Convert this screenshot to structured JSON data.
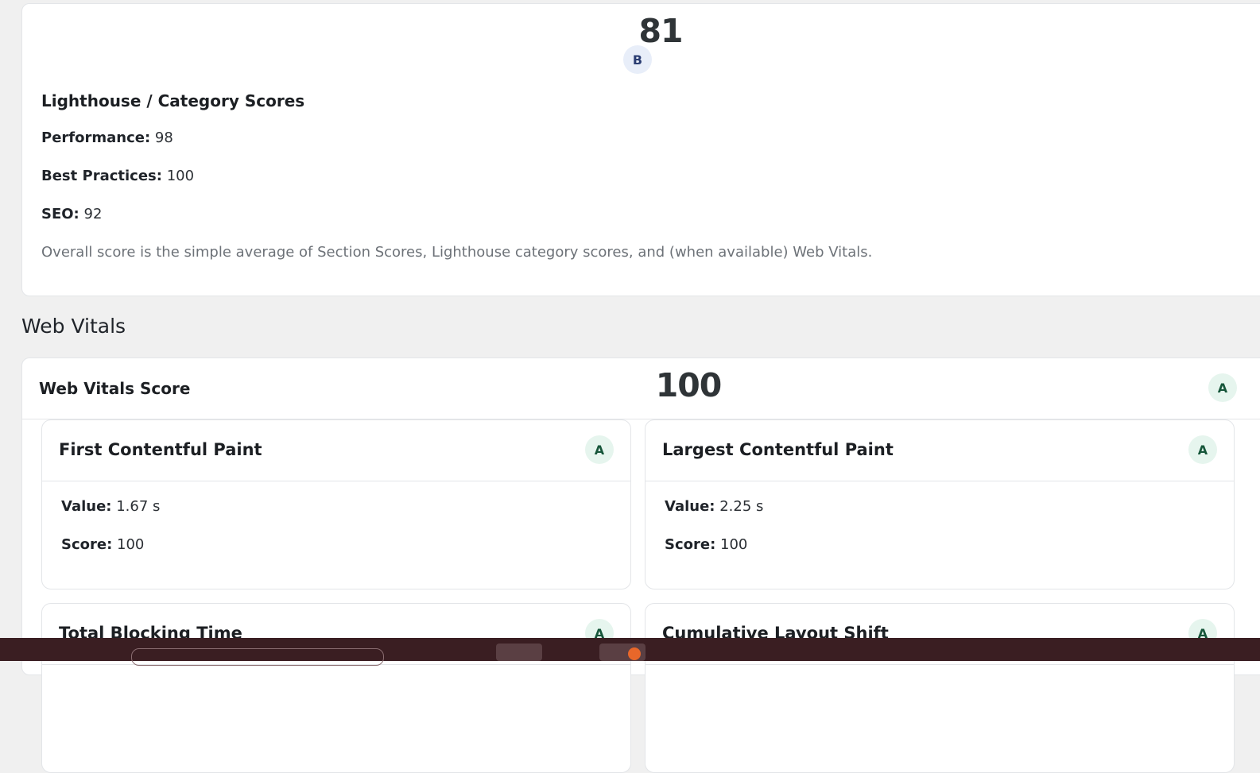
{
  "overall": {
    "score": "81",
    "grade": "B",
    "lighthouse_title": "Lighthouse / Category Scores",
    "categories": [
      {
        "label": "Performance:",
        "value": "98"
      },
      {
        "label": "Best Practices:",
        "value": "100"
      },
      {
        "label": "SEO:",
        "value": "92"
      }
    ],
    "note": "Overall score is the simple average of Section Scores, Lighthouse category scores, and (when available) Web Vitals."
  },
  "web_vitals": {
    "heading": "Web Vitals",
    "score_label": "Web Vitals Score",
    "score": "100",
    "grade": "A",
    "metrics": [
      {
        "title": "First Contentful Paint",
        "grade": "A",
        "value_label": "Value:",
        "value": "1.67 s",
        "score_label": "Score:",
        "score": "100"
      },
      {
        "title": "Largest Contentful Paint",
        "grade": "A",
        "value_label": "Value:",
        "value": "2.25 s",
        "score_label": "Score:",
        "score": "100"
      },
      {
        "title": "Total Blocking Time",
        "grade": "A"
      },
      {
        "title": "Cumulative Layout Shift",
        "grade": "A"
      }
    ]
  },
  "colors": {
    "grade_a_bg": "#e6f5ee",
    "grade_a_text": "#16563a",
    "grade_b_bg": "#e8eef9",
    "grade_b_text": "#2a3d72",
    "taskbar": "#3a1e22"
  }
}
